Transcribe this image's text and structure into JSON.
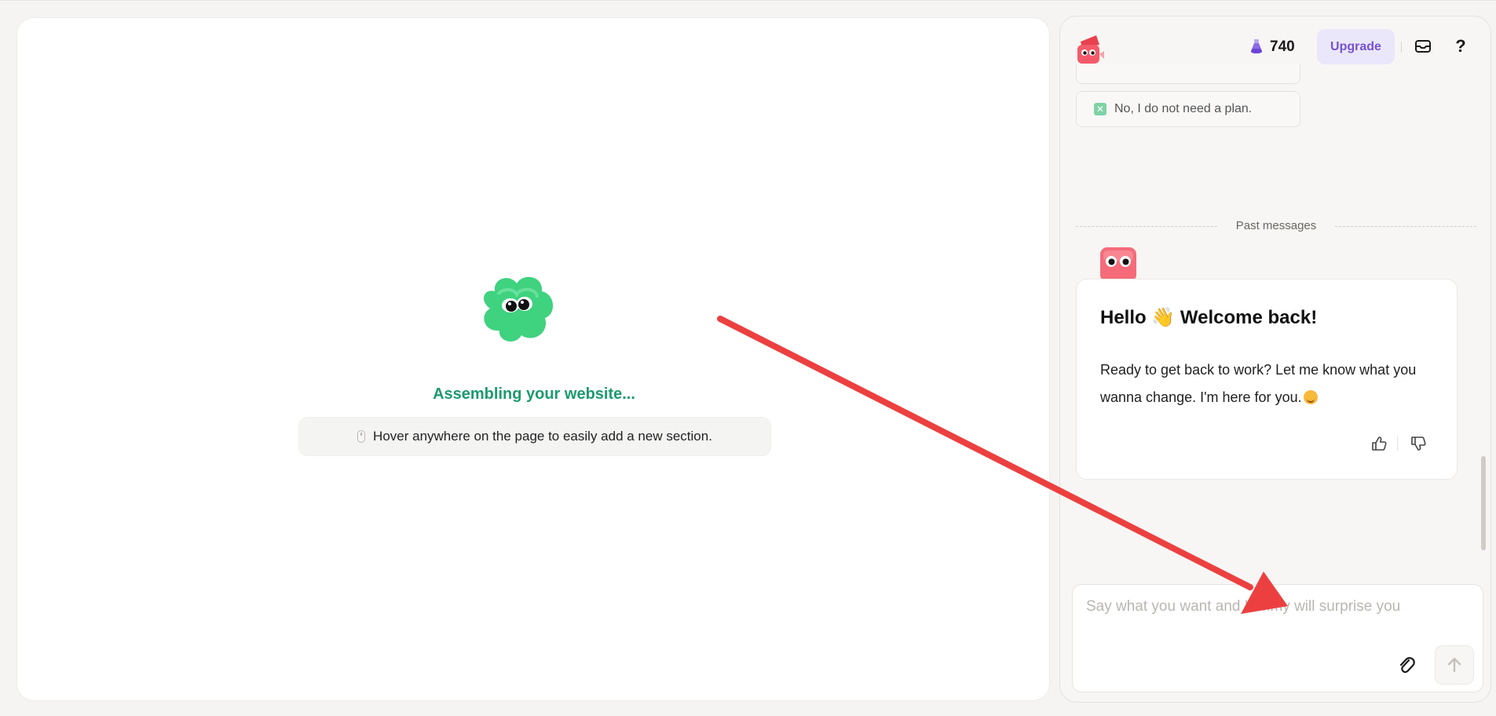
{
  "preview": {
    "status": "Assembling your website...",
    "hint": "Hover anywhere on the page to easily add a new section."
  },
  "header": {
    "credits": "740",
    "upgrade_label": "Upgrade",
    "help_label": "?"
  },
  "chat": {
    "option_no_plan": "No, I do not need a plan.",
    "divider_label": "Past messages",
    "message": {
      "title": "Hello 👋 Welcome back!",
      "body": "Ready to get back to work? Let me know what you wanna change. I'm here for you."
    },
    "input_placeholder": "Say what you want and Kimmy will surprise you"
  },
  "icons": {
    "logo": "kimmy-logo-icon",
    "credits": "potion-icon",
    "inbox": "inbox-icon",
    "attach": "paperclip-icon",
    "send": "arrow-up-icon",
    "thumbs_up": "thumbs-up-icon",
    "thumbs_down": "thumbs-down-icon"
  },
  "colors": {
    "accent_green": "#1d9a6c",
    "upgrade_bg": "#ebe7fb",
    "upgrade_text": "#7652d6",
    "annotation_arrow": "#ec4040"
  }
}
